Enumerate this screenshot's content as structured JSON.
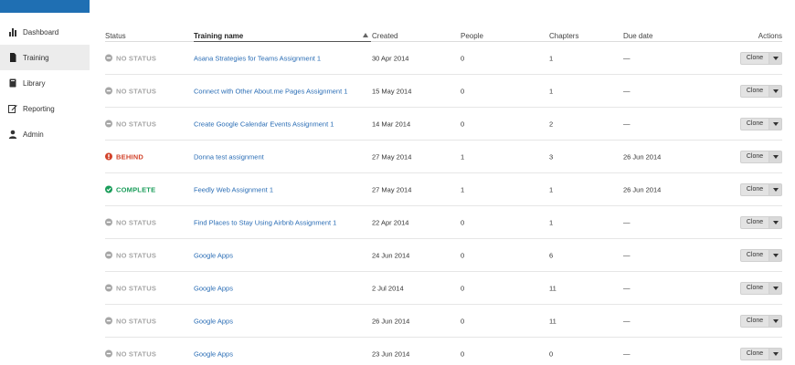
{
  "sidebar": {
    "items": [
      {
        "label": "Dashboard",
        "icon": "bar-chart-icon",
        "active": false
      },
      {
        "label": "Training",
        "icon": "document-icon",
        "active": true
      },
      {
        "label": "Library",
        "icon": "book-icon",
        "active": false
      },
      {
        "label": "Reporting",
        "icon": "pencil-icon",
        "active": false
      },
      {
        "label": "Admin",
        "icon": "user-icon",
        "active": false
      }
    ]
  },
  "table": {
    "headers": {
      "status": "Status",
      "name": "Training name",
      "created": "Created",
      "people": "People",
      "chapters": "Chapters",
      "due": "Due date",
      "actions": "Actions"
    },
    "clone_label": "Clone",
    "status_colors": {
      "none": "#a6a6a6",
      "behind": "#d2432b",
      "complete": "#1a9d5a"
    },
    "rows": [
      {
        "status": "NO STATUS",
        "kind": "none",
        "name": "Asana Strategies for Teams Assignment 1",
        "created": "30 Apr 2014",
        "people": "0",
        "chapters": "1",
        "due": "—"
      },
      {
        "status": "NO STATUS",
        "kind": "none",
        "name": "Connect with Other About.me Pages Assignment 1",
        "created": "15 May 2014",
        "people": "0",
        "chapters": "1",
        "due": "—"
      },
      {
        "status": "NO STATUS",
        "kind": "none",
        "name": "Create Google Calendar Events Assignment 1",
        "created": "14 Mar 2014",
        "people": "0",
        "chapters": "2",
        "due": "—"
      },
      {
        "status": "BEHIND",
        "kind": "behind",
        "name": "Donna test assignment",
        "created": "27 May 2014",
        "people": "1",
        "chapters": "3",
        "due": "26 Jun 2014"
      },
      {
        "status": "COMPLETE",
        "kind": "complete",
        "name": "Feedly Web Assignment 1",
        "created": "27 May 2014",
        "people": "1",
        "chapters": "1",
        "due": "26 Jun 2014"
      },
      {
        "status": "NO STATUS",
        "kind": "none",
        "name": "Find Places to Stay Using Airbnb Assignment 1",
        "created": "22 Apr 2014",
        "people": "0",
        "chapters": "1",
        "due": "—"
      },
      {
        "status": "NO STATUS",
        "kind": "none",
        "name": "Google Apps",
        "created": "24 Jun 2014",
        "people": "0",
        "chapters": "6",
        "due": "—"
      },
      {
        "status": "NO STATUS",
        "kind": "none",
        "name": "Google Apps",
        "created": "2 Jul 2014",
        "people": "0",
        "chapters": "11",
        "due": "—"
      },
      {
        "status": "NO STATUS",
        "kind": "none",
        "name": "Google Apps",
        "created": "26 Jun 2014",
        "people": "0",
        "chapters": "11",
        "due": "—"
      },
      {
        "status": "NO STATUS",
        "kind": "none",
        "name": "Google Apps",
        "created": "23 Jun 2014",
        "people": "0",
        "chapters": "0",
        "due": "—"
      }
    ]
  }
}
